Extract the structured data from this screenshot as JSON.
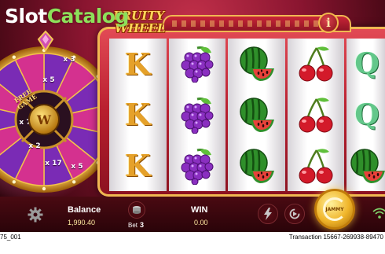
{
  "watermark": {
    "part1": "Slot",
    "part2": "Catalog"
  },
  "logo": {
    "line1": "FRUITY",
    "line2": "WHEEL"
  },
  "info_button": {
    "label": "i"
  },
  "wheel": {
    "segments": [
      "x 3",
      "x 5",
      "FREE GAME",
      "x 7",
      "x 2",
      "x 17",
      "x 5"
    ],
    "free_line1": "FREE",
    "free_line2": "GAME",
    "hub_label": "W",
    "colors": {
      "purple": "#7a2bb5",
      "pink": "#d4318f",
      "gold": "#f2c14b"
    }
  },
  "reels": [
    [
      "K",
      "K",
      "K"
    ],
    [
      "grapes",
      "grapes",
      "grapes"
    ],
    [
      "watermelon",
      "watermelon",
      "watermelon"
    ],
    [
      "cherry",
      "cherry",
      "cherry"
    ],
    [
      "Q",
      "Q",
      "watermelon"
    ]
  ],
  "bottom_bar": {
    "balance_label": "Balance",
    "balance_value": "1,990.40",
    "bet_label": "Bet",
    "bet_value": "3",
    "win_label": "WIN",
    "win_value": "0.00",
    "spin_label": "JAMMY",
    "icons": [
      "gear-icon",
      "coin-stack-icon",
      "lightning-icon",
      "autoplay-icon",
      "wifi-icon"
    ]
  },
  "footer": {
    "left": "75_001",
    "right": "Transaction 15667-269938-89470"
  }
}
